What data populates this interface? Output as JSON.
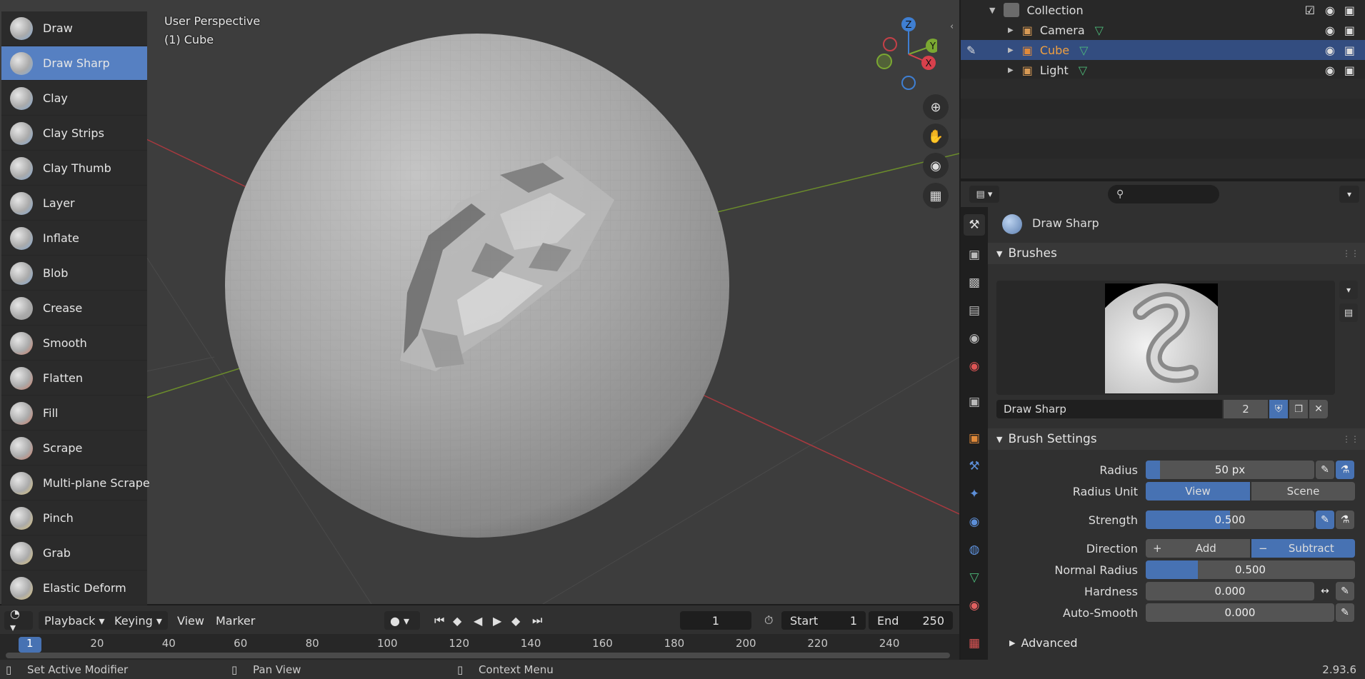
{
  "viewport": {
    "perspective_label": "User Perspective",
    "object_label": "(1) Cube",
    "gizmo": {
      "x": "X",
      "y": "Y",
      "z": "Z"
    }
  },
  "brushes": [
    {
      "label": "Draw",
      "color": "#7fa8d8"
    },
    {
      "label": "Draw Sharp",
      "color": "#7fa8d8"
    },
    {
      "label": "Clay",
      "color": "#7fa8d8"
    },
    {
      "label": "Clay Strips",
      "color": "#7fa8d8"
    },
    {
      "label": "Clay Thumb",
      "color": "#7fa8d8"
    },
    {
      "label": "Layer",
      "color": "#7fa8d8"
    },
    {
      "label": "Inflate",
      "color": "#7fa8d8"
    },
    {
      "label": "Blob",
      "color": "#7fa8d8"
    },
    {
      "label": "Crease",
      "color": "#9a9a9a"
    },
    {
      "label": "Smooth",
      "color": "#d37a62"
    },
    {
      "label": "Flatten",
      "color": "#d37a62"
    },
    {
      "label": "Fill",
      "color": "#d37a62"
    },
    {
      "label": "Scrape",
      "color": "#d37a62"
    },
    {
      "label": "Multi-plane Scrape",
      "color": "#e2c777"
    },
    {
      "label": "Pinch",
      "color": "#e2c777"
    },
    {
      "label": "Grab",
      "color": "#e2c777"
    },
    {
      "label": "Elastic Deform",
      "color": "#e2c777"
    }
  ],
  "active_brush_index": 1,
  "timeline": {
    "menus": [
      "Playback",
      "Keying",
      "View",
      "Marker"
    ],
    "current_frame": "1",
    "start_label": "Start",
    "start_value": "1",
    "end_label": "End",
    "end_value": "250",
    "ticks": [
      "1",
      "20",
      "40",
      "60",
      "80",
      "100",
      "120",
      "140",
      "160",
      "180",
      "200",
      "220",
      "240"
    ]
  },
  "status": {
    "left": "Set Active Modifier",
    "middle": "Pan View",
    "right": "Context Menu",
    "version": "2.93.6"
  },
  "outliner": {
    "collection": "Collection",
    "items": [
      {
        "label": "Camera",
        "selected": false
      },
      {
        "label": "Cube",
        "selected": true
      },
      {
        "label": "Light",
        "selected": false
      }
    ]
  },
  "properties": {
    "search_placeholder": "",
    "brush_title": "Draw Sharp",
    "brushes_panel": "Brushes",
    "brush_name": "Draw Sharp",
    "brush_users": "2",
    "settings_panel": "Brush Settings",
    "radius_label": "Radius",
    "radius_value": "50 px",
    "radius_unit_label": "Radius Unit",
    "radius_unit_options": [
      "View",
      "Scene"
    ],
    "strength_label": "Strength",
    "strength_value": "0.500",
    "strength_fraction": 0.5,
    "direction_label": "Direction",
    "direction_add": "Add",
    "direction_subtract": "Subtract",
    "normal_radius_label": "Normal Radius",
    "normal_radius_value": "0.500",
    "normal_radius_fraction": 0.25,
    "hardness_label": "Hardness",
    "hardness_value": "0.000",
    "auto_smooth_label": "Auto-Smooth",
    "auto_smooth_value": "0.000",
    "advanced_panel": "Advanced"
  }
}
